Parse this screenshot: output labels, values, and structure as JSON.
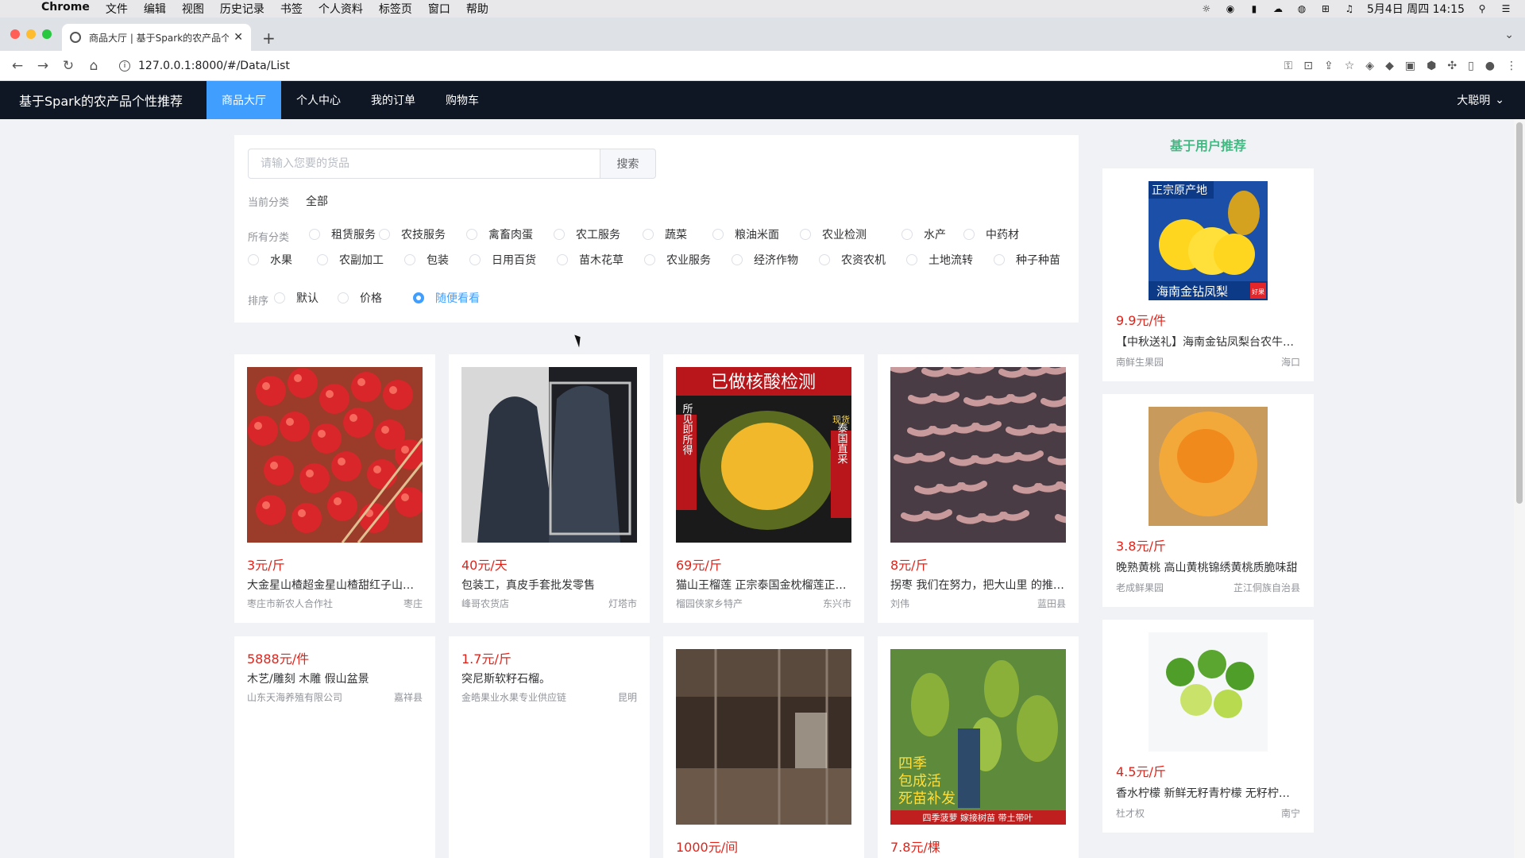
{
  "macbar": {
    "app": "Chrome",
    "menus": [
      "文件",
      "编辑",
      "视图",
      "历史记录",
      "书签",
      "个人资料",
      "标签页",
      "窗口",
      "帮助"
    ],
    "clock": "5月4日 周四 14:15"
  },
  "browser": {
    "tab_title": "商品大厅 | 基于Spark的农产品个",
    "url": "127.0.0.1:8000/#/Data/List"
  },
  "nav": {
    "brand": "基于Spark的农产品个性推荐",
    "items": [
      "商品大厅",
      "个人中心",
      "我的订单",
      "购物车"
    ],
    "active": 0,
    "user": "大聪明"
  },
  "filter": {
    "search_placeholder": "请输入您要的货品",
    "search_button": "搜索",
    "current_label": "当前分类",
    "current_value": "全部",
    "all_label": "所有分类",
    "categories_row1": [
      "租赁服务",
      "农技服务",
      "禽畜肉蛋",
      "农工服务",
      "蔬菜",
      "粮油米面",
      "农业检测",
      "水产",
      "中药材"
    ],
    "categories_row2": [
      "水果",
      "农副加工",
      "包装",
      "日用百货",
      "苗木花草",
      "农业服务",
      "经济作物",
      "农资农机",
      "土地流转",
      "种子种苗"
    ],
    "sort_label": "排序",
    "sort_options": [
      "默认",
      "价格",
      "随便看看"
    ],
    "sort_selected": 2
  },
  "products": [
    {
      "price": "3元/斤",
      "title": "大金星山楂超金星山楂甜红子山楂果新鲜",
      "seller": "枣庄市新农人合作社",
      "loc": "枣庄",
      "img": "hawthorn",
      "accent": "#c8232c"
    },
    {
      "price": "40元/天",
      "title": "包装工，真皮手套批发零售",
      "seller": "峰哥农货店",
      "loc": "灯塔市",
      "img": "gloves",
      "accent": "#2f3540"
    },
    {
      "price": "69元/斤",
      "title": "猫山王榴莲 正宗泰国金枕榴莲正品现货",
      "seller": "榴园侠家乡特产",
      "loc": "东兴市",
      "img": "durian",
      "accent": "#c9a033"
    },
    {
      "price": "8元/斤",
      "title": "拐枣 我们在努力，把大山里 的推荐给大家",
      "seller": "刘伟",
      "loc": "蓝田县",
      "img": "raisin",
      "accent": "#6e5a5e"
    },
    {
      "price": "5888元/件",
      "title": "木艺/雕刻 木雕 假山盆景",
      "seller": "山东天海养殖有限公司",
      "loc": "嘉祥县",
      "img": "none",
      "accent": ""
    },
    {
      "price": "1.7元/斤",
      "title": "突尼斯软籽石榴。",
      "seller": "金皓果业水果专业供应链",
      "loc": "昆明",
      "img": "none",
      "accent": ""
    },
    {
      "price": "1000元/间",
      "title": "",
      "seller": "",
      "loc": "",
      "img": "room",
      "accent": "#4a3d34"
    },
    {
      "price": "7.8元/棵",
      "title": "",
      "seller": "",
      "loc": "",
      "img": "jackfruit",
      "accent": "#3f7a2a"
    }
  ],
  "image_text": {
    "durian_top": "已做核酸检测",
    "durian_left": "所见即所得",
    "durian_right": "泰国直采",
    "durian_badge": "现货",
    "jackfruit_text": "四季包成活死苗补发",
    "jackfruit_bottom": "四季菠萝 嫁接树苗 带土带叶",
    "pineapple_top": "正宗原产地",
    "pineapple_bottom": "海南金钻凤梨",
    "pineapple_badge": "好果"
  },
  "recommend": {
    "title": "基于用户推荐",
    "items": [
      {
        "price": "9.9元/件",
        "title": "【中秋送礼】海南金钻凤梨台农牛奶凤梨",
        "seller": "南鲜生果园",
        "loc": "海口",
        "img": "pineapple"
      },
      {
        "price": "3.8元/斤",
        "title": "晚熟黄桃 高山黄桃锦绣黄桃质脆味甜",
        "seller": "老成鲜果园",
        "loc": "芷江侗族自治县",
        "img": "peach"
      },
      {
        "price": "4.5元/斤",
        "title": "香水柠檬 新鲜无籽青柠檬 无籽柠檬果",
        "seller": "杜才权",
        "loc": "南宁",
        "img": "lime"
      }
    ]
  },
  "colors": {
    "accent": "#409eff",
    "nav_bg": "#101724",
    "price": "#e2231a",
    "rec_title": "#42b983"
  }
}
